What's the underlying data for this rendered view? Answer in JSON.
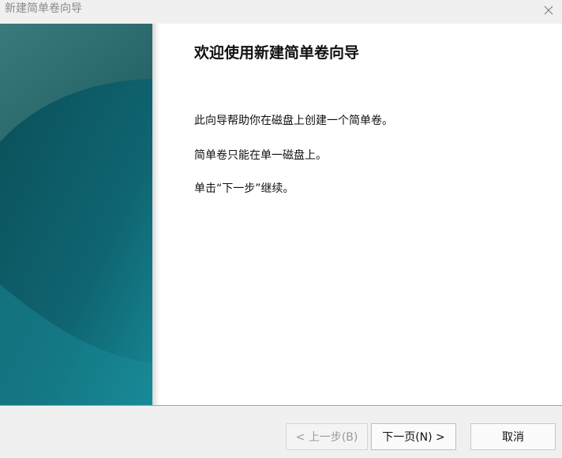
{
  "window": {
    "title": "新建简单卷向导",
    "close_icon": "close-icon"
  },
  "page": {
    "heading": "欢迎使用新建简单卷向导",
    "paragraphs": [
      "此向导帮助你在磁盘上创建一个简单卷。",
      "简单卷只能在单一磁盘上。",
      "单击“下一步”继续。"
    ]
  },
  "buttons": {
    "back": "< 上一步(B)",
    "next": "下一页(N) >",
    "cancel": "取消"
  },
  "colors": {
    "banner_dark": "#0b5b63",
    "banner_light": "#1b8a94",
    "banner_top": "#1d5a5f"
  }
}
